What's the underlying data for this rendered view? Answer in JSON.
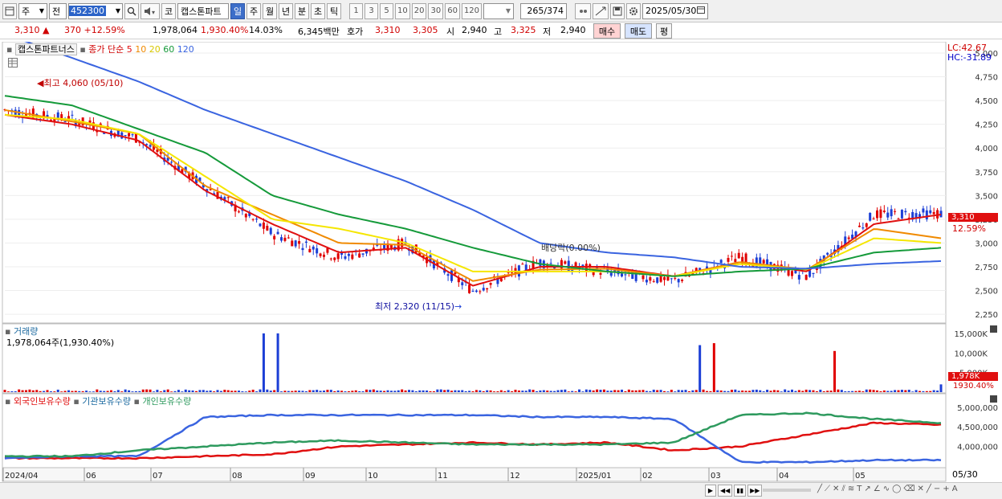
{
  "toolbar": {
    "market": "주",
    "code_type": "전",
    "code": "452300",
    "stock_name": "캡스톤파트",
    "stock_prefix": "코",
    "periods": [
      "일",
      "주",
      "월",
      "년",
      "분",
      "초",
      "틱"
    ],
    "selected_period": "일",
    "intervals": [
      "1",
      "3",
      "5",
      "10",
      "20",
      "30",
      "60",
      "120"
    ],
    "view_count": "265",
    "view_total": "/374",
    "date": "2025/05/30"
  },
  "quote": {
    "price": "3,310",
    "arrow": "▲",
    "change": "370",
    "change_pct": "+12.59%",
    "volume": "1,978,064",
    "volume_pct": "1,930.40%",
    "turnover": "14.03%",
    "amount": "6,345백만",
    "bid_label": "호가",
    "ask": "3,310",
    "bid": "3,305",
    "open_label": "시",
    "open": "2,940",
    "high_label": "고",
    "high": "3,325",
    "low_label": "저",
    "low": "2,940",
    "buy_label": "매수",
    "sell_label": "매도",
    "eval_label": "평"
  },
  "legend": {
    "name": "캡스톤파트너스",
    "ma_label": "종가 단순",
    "ma5": "5",
    "ma10": "10",
    "ma20": "20",
    "ma60": "60",
    "ma120": "120",
    "lc": "LC:42.67",
    "hc": "HC:-31.89",
    "high_note": "최고 4,060 (05/10)",
    "low_note": "최저 2,320 (11/15)",
    "dividend_note": "배당락(0.00%)",
    "last_price_tag": "3,310",
    "last_pct_tag": "12.59%",
    "volume_title": "거래량",
    "volume_value": "1,978,064주(1,930.40%)",
    "vol_tag": "1,978K",
    "vol_pct_tag": "1930.40%",
    "holdings_foreign": "외국인보유수량",
    "holdings_inst": "기관보유수량",
    "holdings_indiv": "개인보유수량",
    "end_date": "05/30"
  },
  "colors": {
    "up": "#e00000",
    "down": "#1c3fd6",
    "ma5": "#e01010",
    "ma10": "#f08a00",
    "ma20": "#f5e600",
    "ma60": "#159a3a",
    "ma120": "#3a64e0",
    "foreign": "#e01010",
    "inst": "#3a64e0",
    "indiv": "#2e9a5e"
  },
  "chart_data": [
    {
      "type": "line",
      "title": "캡스톤파트너스 price",
      "x": [
        "2024/04",
        "05",
        "06",
        "07",
        "08",
        "09",
        "10",
        "11",
        "12",
        "2025/01",
        "02",
        "03",
        "04",
        "05",
        "05/30"
      ],
      "series": [
        {
          "name": "price",
          "values": [
            4400,
            4300,
            4100,
            3600,
            3100,
            2850,
            3000,
            2500,
            2800,
            2700,
            2600,
            2850,
            2650,
            3300,
            3310
          ]
        },
        {
          "name": "5",
          "values": [
            4350,
            4250,
            4080,
            3550,
            3200,
            2900,
            2950,
            2550,
            2750,
            2750,
            2650,
            2800,
            2700,
            3200,
            3300
          ]
        },
        {
          "name": "10",
          "values": [
            4400,
            4280,
            4150,
            3600,
            3300,
            3000,
            2980,
            2600,
            2720,
            2730,
            2650,
            2800,
            2720,
            3150,
            3050
          ]
        },
        {
          "name": "20",
          "values": [
            4350,
            4300,
            4150,
            3700,
            3250,
            3150,
            3000,
            2700,
            2700,
            2700,
            2650,
            2780,
            2720,
            3050,
            3000
          ]
        },
        {
          "name": "60",
          "values": [
            4550,
            4450,
            4200,
            3950,
            3500,
            3300,
            3150,
            2950,
            2780,
            2700,
            2650,
            2700,
            2730,
            2900,
            2950
          ]
        },
        {
          "name": "120",
          "values": [
            5200,
            4950,
            4700,
            4400,
            4150,
            3900,
            3650,
            3350,
            3000,
            2900,
            2850,
            2750,
            2730,
            2780,
            2810
          ]
        }
      ],
      "ylim": [
        2200,
        5000
      ],
      "yticks": [
        2250,
        2500,
        2750,
        3000,
        3250,
        3500,
        3750,
        4000,
        4250,
        4500,
        4750,
        5000
      ],
      "ytick_labels": [
        "2,250",
        "2,500",
        "2,750",
        "3,000",
        "3,250",
        "3,500",
        "3,750",
        "4,000",
        "4,250",
        "4,500",
        "4,750",
        "5,000"
      ],
      "last_value": 3310
    },
    {
      "type": "bar",
      "title": "거래량",
      "x": [
        "2024/04",
        "05",
        "06",
        "07",
        "08",
        "08",
        "08",
        "09",
        "10",
        "11",
        "12",
        "2025/01",
        "02",
        "03",
        "03",
        "04",
        "05",
        "05/30"
      ],
      "values": [
        400,
        300,
        600,
        300,
        15000,
        800,
        15000,
        500,
        350,
        300,
        250,
        400,
        500,
        12000,
        12500,
        10500,
        1000,
        1978
      ],
      "ylim": [
        0,
        16000
      ],
      "yticks": [
        5000,
        10000,
        15000
      ],
      "ytick_labels": [
        "5,000K",
        "10,000K",
        "15,000K"
      ]
    },
    {
      "type": "line",
      "title": "보유수량",
      "x": [
        "2024/04",
        "05",
        "06",
        "07",
        "08",
        "09",
        "10",
        "11",
        "12",
        "2025/01",
        "02",
        "03",
        "04",
        "05",
        "05/30"
      ],
      "series": [
        {
          "name": "외국인보유수량",
          "values": [
            3700,
            3700,
            3700,
            3750,
            3800,
            4000,
            4050,
            4100,
            4050,
            4100,
            3900,
            4000,
            4300,
            4600,
            4550
          ]
        },
        {
          "name": "기관보유수량",
          "values": [
            3700,
            3750,
            3750,
            4750,
            4800,
            4800,
            4800,
            4800,
            4750,
            4750,
            4700,
            3600,
            3600,
            3650,
            3650
          ]
        },
        {
          "name": "개인보유수량",
          "values": [
            3750,
            3750,
            3900,
            4000,
            4100,
            4150,
            4100,
            4050,
            4050,
            4050,
            4100,
            4800,
            4850,
            4700,
            4600
          ]
        }
      ],
      "ylim": [
        3500,
        5200
      ],
      "yticks": [
        4000000,
        4500000,
        5000000
      ],
      "ytick_labels": [
        "4,000,000",
        "4,500,000",
        "5,000,000"
      ]
    }
  ],
  "xaxis": {
    "labels": [
      "2024/04",
      "06",
      "07",
      "08",
      "09",
      "10",
      "11",
      "12",
      "2025/01",
      "02",
      "03",
      "04",
      "05"
    ]
  }
}
